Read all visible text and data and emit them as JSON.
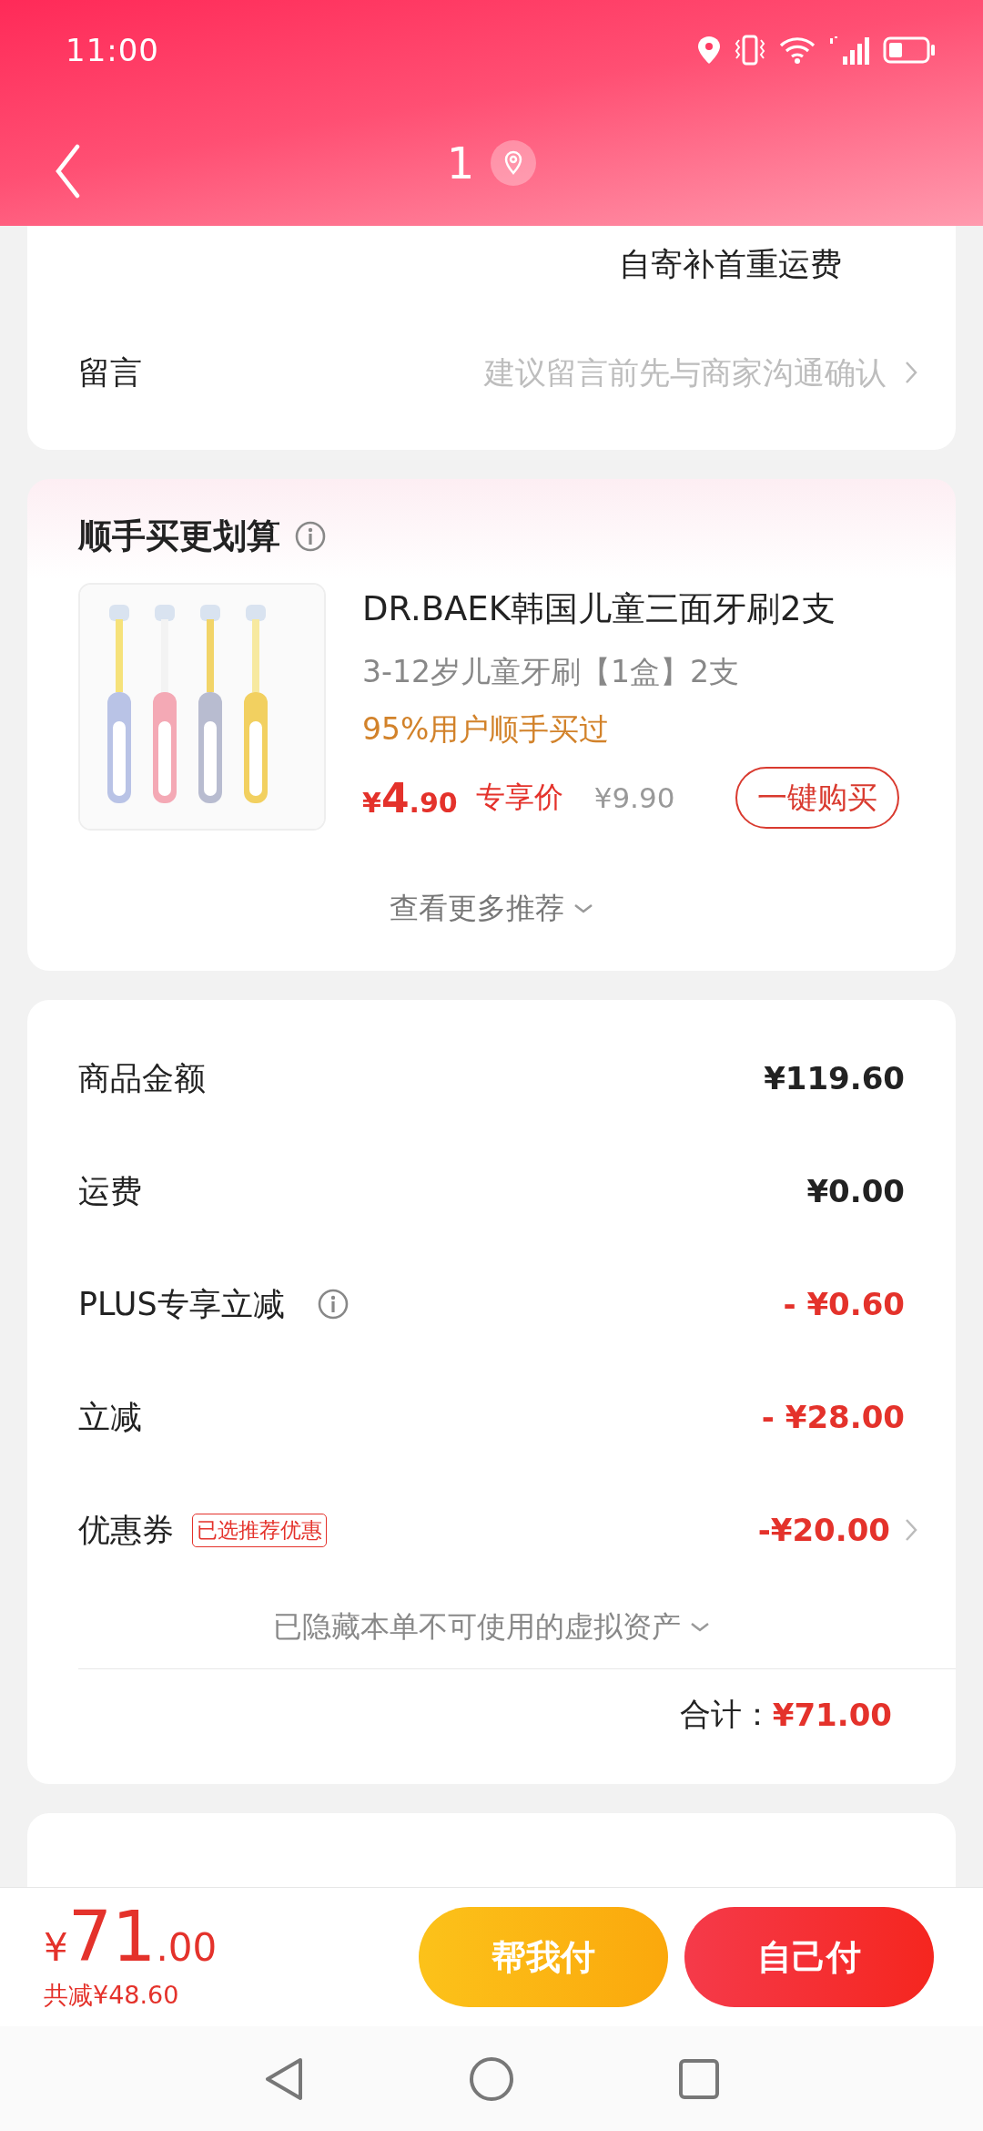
{
  "status_bar": {
    "time": "11:00"
  },
  "header": {
    "title": "1"
  },
  "delivery_card": {
    "shipping_note": "自寄补首重运费",
    "message": {
      "label": "留言",
      "placeholder": "建议留言前先与商家沟通确认"
    }
  },
  "recommend": {
    "title": "顺手买更划算",
    "product": {
      "name": "DR.BAEK韩国儿童三面牙刷2支",
      "spec": "3-12岁儿童牙刷【1盒】2支",
      "social_proof": "95%用户顺手买过",
      "price": "¥4.90",
      "price_tag": "专享价",
      "original_price": "¥9.90",
      "buy_button": "一键购买"
    },
    "more_link": "查看更多推荐"
  },
  "summary": {
    "rows": [
      {
        "label": "商品金额",
        "value": "¥119.60",
        "kind": "amount",
        "info": false,
        "link": false
      },
      {
        "label": "运费",
        "value": "¥0.00",
        "kind": "amount",
        "info": false,
        "link": false
      },
      {
        "label": "PLUS专享立减",
        "value": "- ¥0.60",
        "kind": "discount",
        "info": true,
        "link": false
      },
      {
        "label": "立减",
        "value": "- ¥28.00",
        "kind": "discount",
        "info": false,
        "link": false
      },
      {
        "label": "优惠券",
        "tag": "已选推荐优惠",
        "value": "-¥20.00",
        "kind": "discount",
        "info": false,
        "link": true
      }
    ],
    "hidden_note": "已隐藏本单不可使用的虚拟资产",
    "total_label": "合计：",
    "total_value": "¥71.00"
  },
  "checkout": {
    "price": "¥71.00",
    "saved": "共减¥48.60",
    "buttons": [
      {
        "label": "帮我付",
        "kind": "secondary"
      },
      {
        "label": "自己付",
        "kind": "primary"
      }
    ]
  }
}
